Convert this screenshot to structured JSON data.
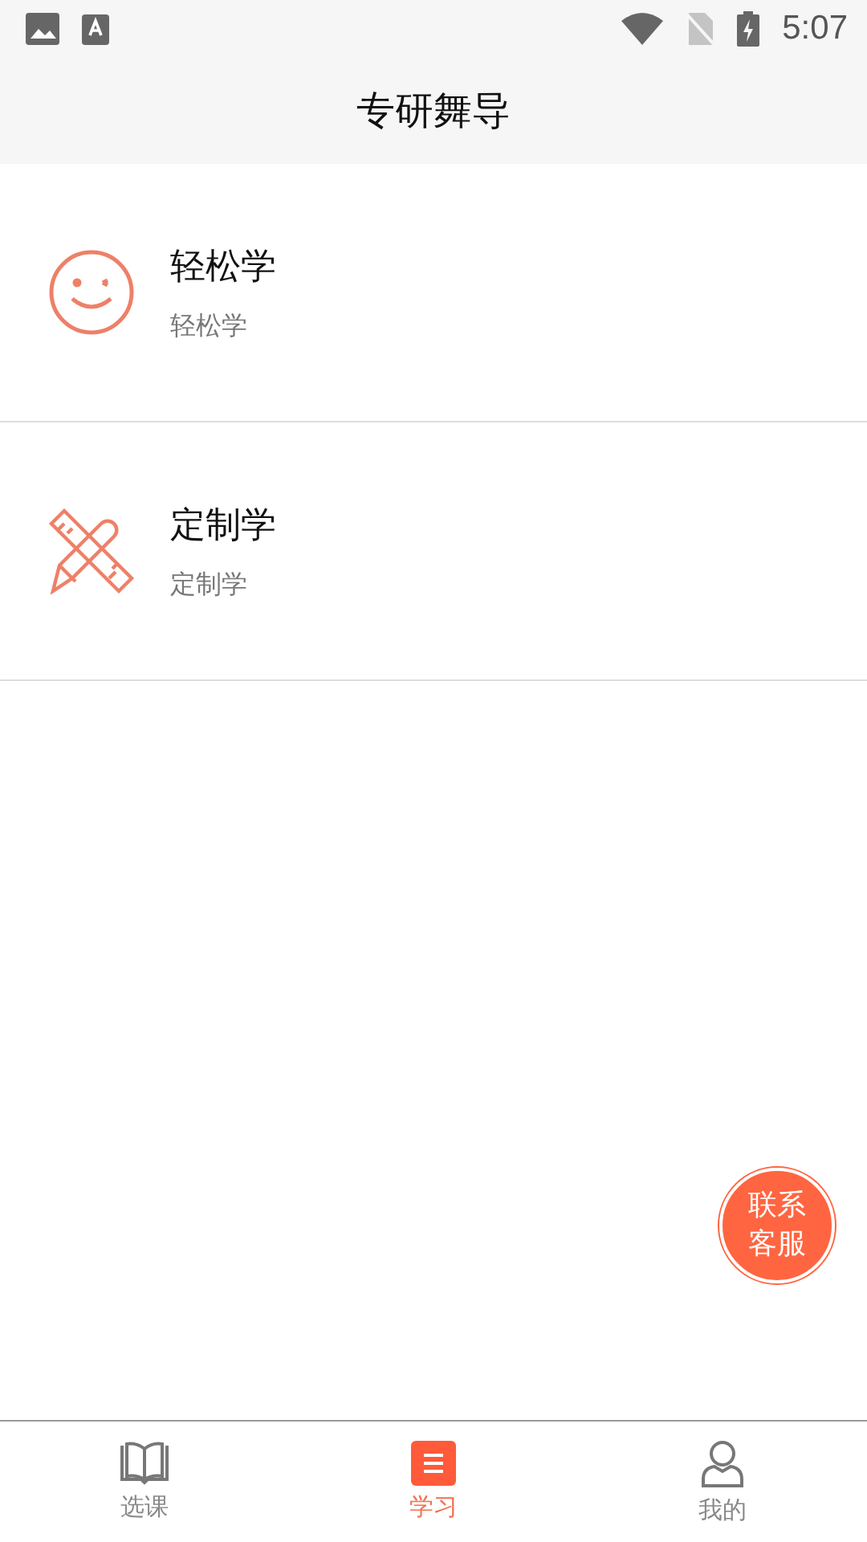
{
  "status_bar": {
    "time": "5:07"
  },
  "header": {
    "title": "专研舞导"
  },
  "items": [
    {
      "kind": "smile",
      "title": "轻松学",
      "subtitle": "轻松学"
    },
    {
      "kind": "ruler",
      "title": "定制学",
      "subtitle": "定制学"
    }
  ],
  "fab": {
    "line1": "联系",
    "line2": "客服"
  },
  "tabs": [
    {
      "kind": "book",
      "label": "选课",
      "selected": false
    },
    {
      "kind": "list",
      "label": "学习",
      "selected": true
    },
    {
      "kind": "person",
      "label": "我的",
      "selected": false
    }
  ]
}
